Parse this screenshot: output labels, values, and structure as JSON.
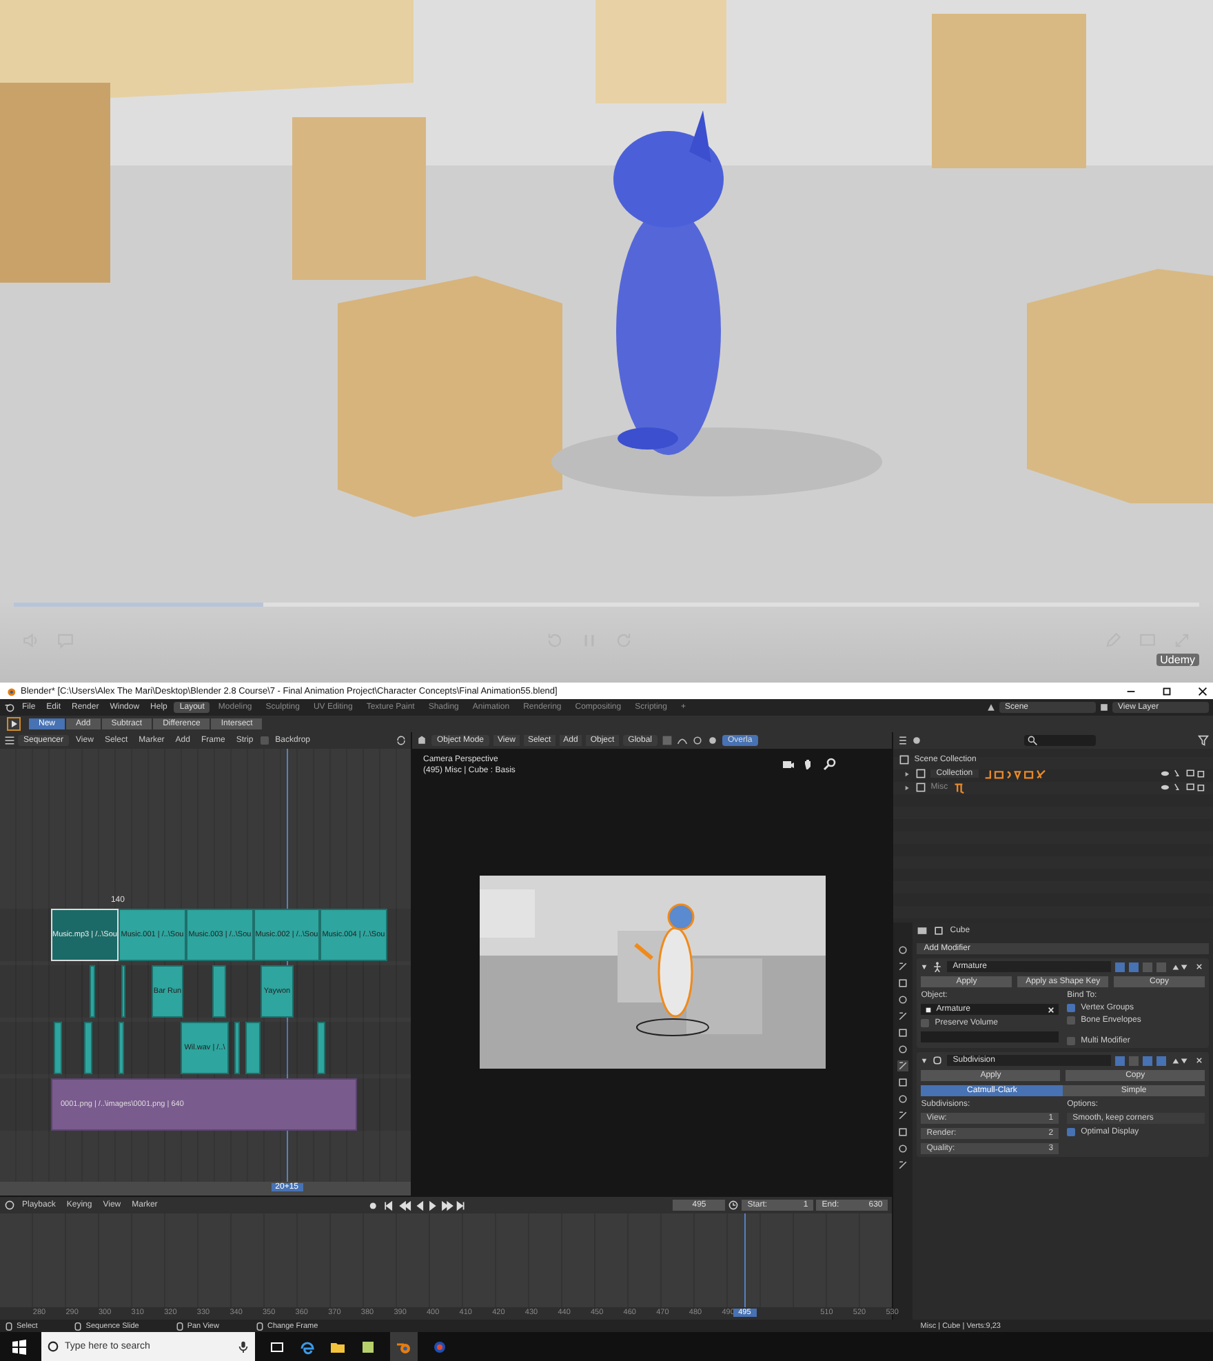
{
  "video": {
    "progress": {
      "level": 0.21
    },
    "logo": "Udemy"
  },
  "window": {
    "title": "Blender* [C:\\Users\\Alex The Mari\\Desktop\\Blender 2.8 Course\\7 - Final Animation Project\\Character Concepts\\Final Animation55.blend]"
  },
  "menu": [
    "File",
    "Edit",
    "Render",
    "Window",
    "Help"
  ],
  "workspaces": [
    {
      "label": "Layout",
      "selected": true
    },
    {
      "label": "Modeling",
      "selected": false
    },
    {
      "label": "Sculpting",
      "selected": false
    },
    {
      "label": "UV Editing",
      "selected": false
    },
    {
      "label": "Texture Paint",
      "selected": false
    },
    {
      "label": "Shading",
      "selected": false
    },
    {
      "label": "Animation",
      "selected": false
    },
    {
      "label": "Rendering",
      "selected": false
    },
    {
      "label": "Compositing",
      "selected": false
    },
    {
      "label": "Scripting",
      "selected": false
    }
  ],
  "add_workspace": "+",
  "scene": "Scene",
  "view_layer": "View Layer",
  "boolean_ops": [
    {
      "label": "New",
      "selected": true
    },
    {
      "label": "Add",
      "selected": false
    },
    {
      "label": "Subtract",
      "selected": false
    },
    {
      "label": "Difference",
      "selected": false
    },
    {
      "label": "Intersect",
      "selected": false
    }
  ],
  "sequencer": {
    "editor": "Sequencer",
    "menu": [
      "View",
      "Select",
      "Marker",
      "Add",
      "Frame",
      "Strip"
    ],
    "backdrop": {
      "label": "Backdrop",
      "checked": false
    },
    "frame_marker": "140",
    "current_frame": "20+15",
    "tracks": [
      {
        "strips": [
          {
            "kind": "sound",
            "label": "Music.mp3 | /..\\Sou",
            "selected": true
          },
          {
            "kind": "sound",
            "label": "Music.001 | /..\\Sou",
            "selected": false
          },
          {
            "kind": "sound",
            "label": "Music.003 | /..\\Sou",
            "selected": false
          },
          {
            "kind": "sound",
            "label": "Music.002 | /..\\Sou",
            "selected": false
          },
          {
            "kind": "sound",
            "label": "Music.004 | /..\\Sou",
            "selected": false
          }
        ]
      },
      {
        "strips": [
          {
            "kind": "sound",
            "selected": false
          },
          {
            "kind": "sound",
            "selected": false
          },
          {
            "kind": "sound",
            "label": "Bar Run",
            "selected": false
          },
          {
            "kind": "sound",
            "selected": false
          },
          {
            "kind": "sound",
            "label": "Yaywon",
            "selected": false
          }
        ]
      },
      {
        "strips": [
          {
            "kind": "sound",
            "selected": false
          },
          {
            "kind": "sound",
            "selected": false
          },
          {
            "kind": "sound",
            "selected": false
          },
          {
            "kind": "sound",
            "label": "Wil.wav | /..\\",
            "selected": false
          },
          {
            "kind": "sound",
            "selected": false
          },
          {
            "kind": "sound",
            "selected": false
          },
          {
            "kind": "sound",
            "selected": false
          }
        ]
      },
      {
        "strips": [
          {
            "label": "0001.png | /..\\images\\0001.png | 640",
            "selected": false
          }
        ]
      }
    ]
  },
  "viewport": {
    "mode": "Object Mode",
    "menu": [
      "View",
      "Select",
      "Add",
      "Object"
    ],
    "orientation": "Global",
    "overlays": "Overla",
    "camera": "Camera Perspective",
    "info": "(495) Misc | Cube : Basis"
  },
  "outliner": {
    "items": [
      {
        "label": "Scene Collection",
        "children": [
          {
            "label": "Collection"
          },
          {
            "label": "Misc"
          }
        ]
      }
    ]
  },
  "properties": {
    "object": "Cube",
    "add_modifier": "Add Modifier",
    "modifiers": [
      {
        "kind": "armature",
        "name": "Armature",
        "toggles": [
          {
            "on": true
          },
          {
            "on": true
          },
          {
            "on": false
          },
          {
            "on": false
          }
        ],
        "buttons": [
          "Apply",
          "Apply as Shape Key",
          "Copy"
        ],
        "object_label": "Object:",
        "object": "Armature",
        "preserve_volume": {
          "label": "Preserve Volume",
          "checked": false
        },
        "bind_label": "Bind To:",
        "bind_to": [
          {
            "label": "Vertex Groups",
            "checked": true
          },
          {
            "label": "Bone Envelopes",
            "checked": false
          }
        ],
        "multi_modifier": {
          "label": "Multi Modifier",
          "checked": false
        }
      },
      {
        "kind": "subdivision",
        "name": "Subdivision",
        "toggles": [
          {
            "on": true
          },
          {
            "on": false
          },
          {
            "on": true
          },
          {
            "on": true
          }
        ],
        "buttons": [
          "Apply",
          "Copy"
        ],
        "algorithms": [
          {
            "label": "Catmull-Clark",
            "selected": true
          },
          {
            "label": "Simple",
            "selected": false
          }
        ],
        "subdivisions_label": "Subdivisions:",
        "levels": [
          {
            "label": "View:",
            "value": "1"
          },
          {
            "label": "Render:",
            "value": "2"
          },
          {
            "label": "Quality:",
            "value": "3"
          }
        ],
        "options_label": "Options:",
        "uv_smooth": "Smooth, keep corners",
        "optimal_display": {
          "label": "Optimal Display",
          "checked": true
        }
      }
    ]
  },
  "timeline": {
    "menu": [
      "Playback",
      "Keying",
      "View",
      "Marker"
    ],
    "frame": "495",
    "start_label": "Start:",
    "start": "1",
    "end_label": "End:",
    "end": "630",
    "ruler": [
      {
        "label": "280",
        "selected": false
      },
      {
        "label": "290",
        "selected": false
      },
      {
        "label": "300",
        "selected": false
      },
      {
        "label": "310",
        "selected": false
      },
      {
        "label": "320",
        "selected": false
      },
      {
        "label": "330",
        "selected": false
      },
      {
        "label": "340",
        "selected": false
      },
      {
        "label": "350",
        "selected": false
      },
      {
        "label": "360",
        "selected": false
      },
      {
        "label": "370",
        "selected": false
      },
      {
        "label": "380",
        "selected": false
      },
      {
        "label": "390",
        "selected": false
      },
      {
        "label": "400",
        "selected": false
      },
      {
        "label": "410",
        "selected": false
      },
      {
        "label": "420",
        "selected": false
      },
      {
        "label": "430",
        "selected": false
      },
      {
        "label": "440",
        "selected": false
      },
      {
        "label": "450",
        "selected": false
      },
      {
        "label": "460",
        "selected": false
      },
      {
        "label": "470",
        "selected": false
      },
      {
        "label": "480",
        "selected": false
      },
      {
        "label": "490",
        "selected": false
      },
      {
        "label": "495",
        "selected": true
      },
      {
        "label": "510",
        "selected": false
      },
      {
        "label": "520",
        "selected": false
      },
      {
        "label": "530",
        "selected": false
      }
    ]
  },
  "status_bar": {
    "hints": [
      "Select",
      "Sequence Slide",
      "Pan View",
      "Change Frame"
    ],
    "info": "Misc | Cube | Verts:9,23"
  },
  "taskbar": {
    "search": {
      "placeholder": "Type here to search"
    }
  }
}
